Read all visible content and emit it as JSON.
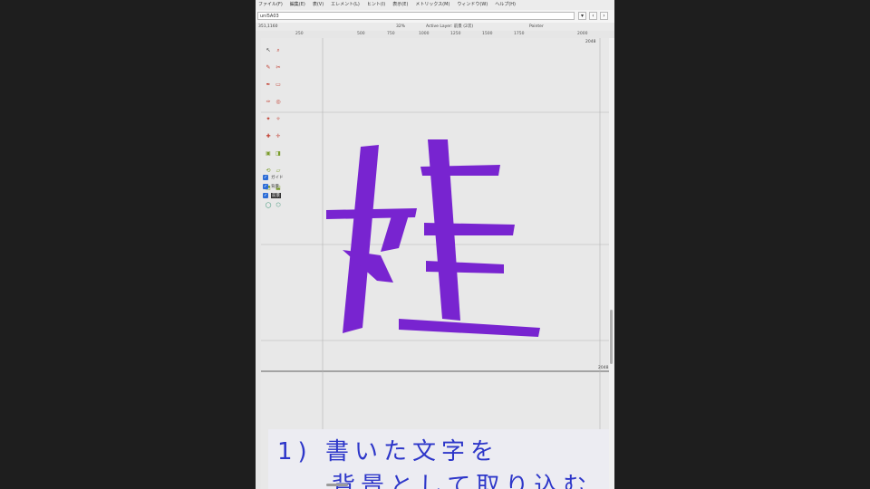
{
  "menu": [
    "ファイル(F)",
    "編集(E)",
    "表(V)",
    "エレメント(L)",
    "ヒント(I)",
    "表示(E)",
    "メトリックス(M)",
    "ウィンドウ(W)",
    "ヘルプ(H)"
  ],
  "path": {
    "value": "uni5A03"
  },
  "toolbar": {
    "coords": "351,1160",
    "zoom": "32%",
    "active_layer": "Active Layer: 前景 (2次)",
    "mode": "Pointer"
  },
  "ruler": {
    "ticks": [
      "250",
      "500",
      "750",
      "1000",
      "1250",
      "1500",
      "1750",
      "2000"
    ]
  },
  "guides": {
    "top_value": "2048",
    "bottom_value": "2048"
  },
  "layers": [
    {
      "label": "ガイド",
      "checked": true
    },
    {
      "label": "背景",
      "checked": true
    },
    {
      "label": "前景",
      "checked": true
    }
  ],
  "caption": {
    "line1": "1) 書いた文字を",
    "line2": "背景として取り込む"
  },
  "colors": {
    "glyph": "#7824d0",
    "caption_text": "#2d36c9",
    "selection": "#2b6cd6"
  }
}
